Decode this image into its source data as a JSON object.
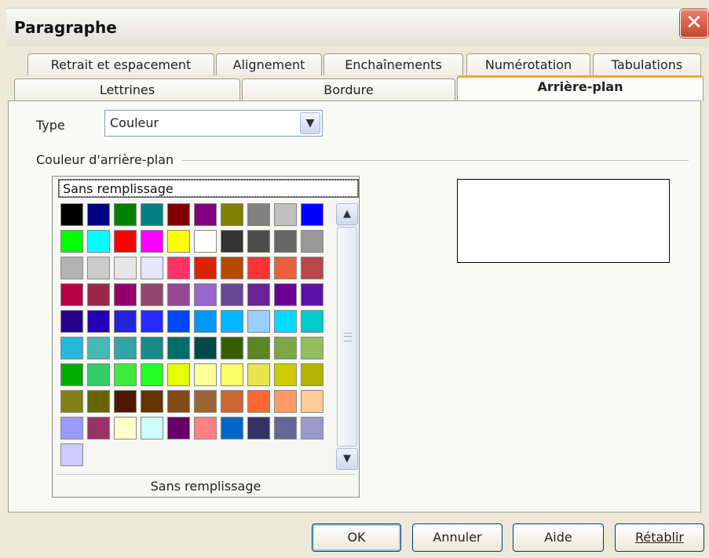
{
  "dialog": {
    "title": "Paragraphe",
    "close_glyph": "✕"
  },
  "tabs_row1": [
    {
      "label": "Retrait et espacement"
    },
    {
      "label": "Alignement"
    },
    {
      "label": "Enchaînements"
    },
    {
      "label": "Numérotation"
    },
    {
      "label": "Tabulations"
    }
  ],
  "tabs_row2": [
    {
      "label": "Lettrines"
    },
    {
      "label": "Bordure"
    },
    {
      "label": "Arrière-plan",
      "active": true
    }
  ],
  "type": {
    "label": "Type",
    "value": "Couleur"
  },
  "background_group": {
    "label": "Couleur d'arrière-plan"
  },
  "palette": {
    "none_option": "Sans remplissage",
    "selected_name": "Sans remplissage",
    "colors": [
      "#000000",
      "#000080",
      "#008000",
      "#008080",
      "#800000",
      "#800080",
      "#808000",
      "#808080",
      "#c0c0c0",
      "#0000ff",
      "#00ff00",
      "#00ffff",
      "#ff0000",
      "#ff00ff",
      "#ffff00",
      "#ffffff",
      "#333333",
      "#4d4d4d",
      "#666666",
      "#999999",
      "#b3b3b3",
      "#cccccc",
      "#e6e6e6",
      "#e6e6ff",
      "#ff3366",
      "#dc2300",
      "#b84700",
      "#ff3333",
      "#eb613d",
      "#b84747",
      "#b80047",
      "#99284c",
      "#94006b",
      "#94476b",
      "#944794",
      "#9966cc",
      "#6b4794",
      "#6b2394",
      "#6b0094",
      "#5e11a6",
      "#28008c",
      "#2300b8",
      "#2323dc",
      "#2a2aff",
      "#0047ff",
      "#0099ff",
      "#00b8ff",
      "#99ccff",
      "#00dcff",
      "#00cccc",
      "#23b8dc",
      "#47b8b8",
      "#33a3a3",
      "#198a8a",
      "#006b6b",
      "#004a4a",
      "#355e00",
      "#5c8526",
      "#7da647",
      "#94bd5e",
      "#00ae00",
      "#33cc66",
      "#3deb3d",
      "#23ff23",
      "#e6ff00",
      "#ffff99",
      "#ffff66",
      "#e6e64c",
      "#cccc00",
      "#b3b300",
      "#808019",
      "#666600",
      "#4c1900",
      "#663300",
      "#804c19",
      "#996633",
      "#cc6633",
      "#ff6633",
      "#ff9966",
      "#ffcc99",
      "#9999ff",
      "#993366",
      "#ffffcc",
      "#ccffff",
      "#660066",
      "#ff8080",
      "#0066cc",
      "#333366",
      "#666699",
      "#9999cc",
      "#ccccff"
    ]
  },
  "icons": {
    "dropdown": "chevron-down-icon",
    "scroll_up": "chevron-up-icon",
    "scroll_down": "chevron-down-icon",
    "close": "close-icon"
  },
  "buttons": {
    "ok": "OK",
    "cancel": "Annuler",
    "help": "Aide",
    "reset": "Rétablir"
  }
}
